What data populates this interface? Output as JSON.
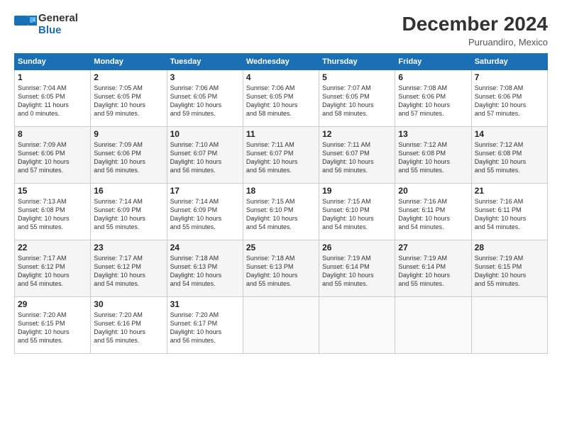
{
  "header": {
    "logo_general": "General",
    "logo_blue": "Blue",
    "title": "December 2024",
    "subtitle": "Puruandiro, Mexico"
  },
  "days_of_week": [
    "Sunday",
    "Monday",
    "Tuesday",
    "Wednesday",
    "Thursday",
    "Friday",
    "Saturday"
  ],
  "weeks": [
    [
      {
        "day": "1",
        "info": "Sunrise: 7:04 AM\nSunset: 6:05 PM\nDaylight: 11 hours\nand 0 minutes."
      },
      {
        "day": "2",
        "info": "Sunrise: 7:05 AM\nSunset: 6:05 PM\nDaylight: 10 hours\nand 59 minutes."
      },
      {
        "day": "3",
        "info": "Sunrise: 7:06 AM\nSunset: 6:05 PM\nDaylight: 10 hours\nand 59 minutes."
      },
      {
        "day": "4",
        "info": "Sunrise: 7:06 AM\nSunset: 6:05 PM\nDaylight: 10 hours\nand 58 minutes."
      },
      {
        "day": "5",
        "info": "Sunrise: 7:07 AM\nSunset: 6:05 PM\nDaylight: 10 hours\nand 58 minutes."
      },
      {
        "day": "6",
        "info": "Sunrise: 7:08 AM\nSunset: 6:06 PM\nDaylight: 10 hours\nand 57 minutes."
      },
      {
        "day": "7",
        "info": "Sunrise: 7:08 AM\nSunset: 6:06 PM\nDaylight: 10 hours\nand 57 minutes."
      }
    ],
    [
      {
        "day": "8",
        "info": "Sunrise: 7:09 AM\nSunset: 6:06 PM\nDaylight: 10 hours\nand 57 minutes."
      },
      {
        "day": "9",
        "info": "Sunrise: 7:09 AM\nSunset: 6:06 PM\nDaylight: 10 hours\nand 56 minutes."
      },
      {
        "day": "10",
        "info": "Sunrise: 7:10 AM\nSunset: 6:07 PM\nDaylight: 10 hours\nand 56 minutes."
      },
      {
        "day": "11",
        "info": "Sunrise: 7:11 AM\nSunset: 6:07 PM\nDaylight: 10 hours\nand 56 minutes."
      },
      {
        "day": "12",
        "info": "Sunrise: 7:11 AM\nSunset: 6:07 PM\nDaylight: 10 hours\nand 56 minutes."
      },
      {
        "day": "13",
        "info": "Sunrise: 7:12 AM\nSunset: 6:08 PM\nDaylight: 10 hours\nand 55 minutes."
      },
      {
        "day": "14",
        "info": "Sunrise: 7:12 AM\nSunset: 6:08 PM\nDaylight: 10 hours\nand 55 minutes."
      }
    ],
    [
      {
        "day": "15",
        "info": "Sunrise: 7:13 AM\nSunset: 6:08 PM\nDaylight: 10 hours\nand 55 minutes."
      },
      {
        "day": "16",
        "info": "Sunrise: 7:14 AM\nSunset: 6:09 PM\nDaylight: 10 hours\nand 55 minutes."
      },
      {
        "day": "17",
        "info": "Sunrise: 7:14 AM\nSunset: 6:09 PM\nDaylight: 10 hours\nand 55 minutes."
      },
      {
        "day": "18",
        "info": "Sunrise: 7:15 AM\nSunset: 6:10 PM\nDaylight: 10 hours\nand 54 minutes."
      },
      {
        "day": "19",
        "info": "Sunrise: 7:15 AM\nSunset: 6:10 PM\nDaylight: 10 hours\nand 54 minutes."
      },
      {
        "day": "20",
        "info": "Sunrise: 7:16 AM\nSunset: 6:11 PM\nDaylight: 10 hours\nand 54 minutes."
      },
      {
        "day": "21",
        "info": "Sunrise: 7:16 AM\nSunset: 6:11 PM\nDaylight: 10 hours\nand 54 minutes."
      }
    ],
    [
      {
        "day": "22",
        "info": "Sunrise: 7:17 AM\nSunset: 6:12 PM\nDaylight: 10 hours\nand 54 minutes."
      },
      {
        "day": "23",
        "info": "Sunrise: 7:17 AM\nSunset: 6:12 PM\nDaylight: 10 hours\nand 54 minutes."
      },
      {
        "day": "24",
        "info": "Sunrise: 7:18 AM\nSunset: 6:13 PM\nDaylight: 10 hours\nand 54 minutes."
      },
      {
        "day": "25",
        "info": "Sunrise: 7:18 AM\nSunset: 6:13 PM\nDaylight: 10 hours\nand 55 minutes."
      },
      {
        "day": "26",
        "info": "Sunrise: 7:19 AM\nSunset: 6:14 PM\nDaylight: 10 hours\nand 55 minutes."
      },
      {
        "day": "27",
        "info": "Sunrise: 7:19 AM\nSunset: 6:14 PM\nDaylight: 10 hours\nand 55 minutes."
      },
      {
        "day": "28",
        "info": "Sunrise: 7:19 AM\nSunset: 6:15 PM\nDaylight: 10 hours\nand 55 minutes."
      }
    ],
    [
      {
        "day": "29",
        "info": "Sunrise: 7:20 AM\nSunset: 6:15 PM\nDaylight: 10 hours\nand 55 minutes."
      },
      {
        "day": "30",
        "info": "Sunrise: 7:20 AM\nSunset: 6:16 PM\nDaylight: 10 hours\nand 55 minutes."
      },
      {
        "day": "31",
        "info": "Sunrise: 7:20 AM\nSunset: 6:17 PM\nDaylight: 10 hours\nand 56 minutes."
      },
      {
        "day": "",
        "info": ""
      },
      {
        "day": "",
        "info": ""
      },
      {
        "day": "",
        "info": ""
      },
      {
        "day": "",
        "info": ""
      }
    ]
  ]
}
